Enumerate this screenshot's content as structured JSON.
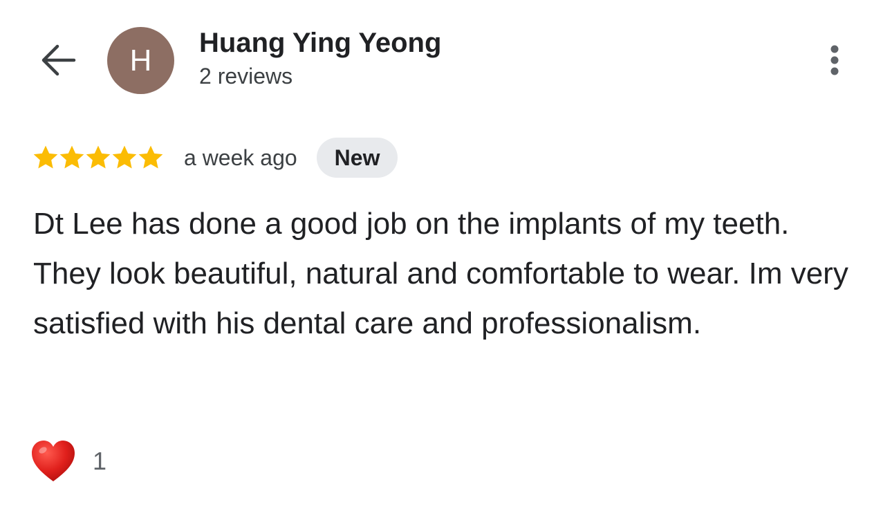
{
  "header": {
    "back_icon": "arrow-left-icon",
    "avatar_letter": "H",
    "avatar_color": "#8d6e63",
    "user_name": "Huang Ying Yeong",
    "review_count": "2 reviews",
    "more_icon": "more-vertical-icon"
  },
  "review": {
    "rating": 5,
    "max_rating": 5,
    "star_color": "#fbbc04",
    "time": "a week ago",
    "badge": "New",
    "text": "Dt Lee has done a good job on the implants of my teeth. They look beautiful, natural and comfortable to wear. Im very satisfied with his dental care and professionalism."
  },
  "reaction": {
    "icon": "heart-icon",
    "color": "#e0201c",
    "count": "1"
  }
}
